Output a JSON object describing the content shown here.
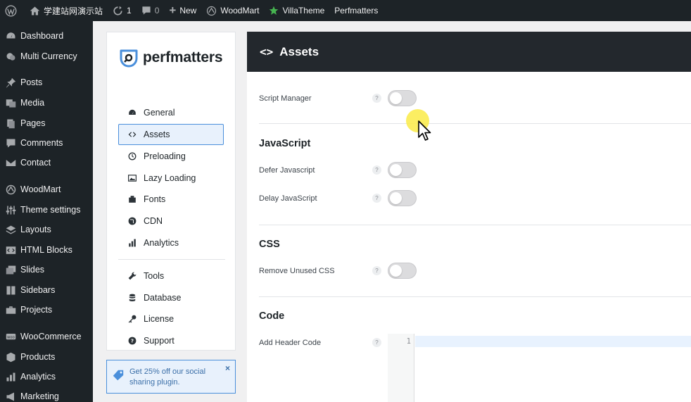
{
  "adminbar": {
    "site_name": "学建站网演示站",
    "updates_count": "1",
    "comments_count": "0",
    "new_label": "New",
    "woodmart_label": "WoodMart",
    "villatheme_label": "VillaTheme",
    "perfmatters_label": "Perfmatters"
  },
  "sidebar": {
    "items": [
      {
        "label": "Dashboard",
        "icon": "dashboard-icon"
      },
      {
        "label": "Multi Currency",
        "icon": "currency-icon"
      },
      {
        "label": "Posts",
        "icon": "pin-icon"
      },
      {
        "label": "Media",
        "icon": "media-icon"
      },
      {
        "label": "Pages",
        "icon": "pages-icon"
      },
      {
        "label": "Comments",
        "icon": "comment-icon"
      },
      {
        "label": "Contact",
        "icon": "mail-icon"
      },
      {
        "label": "WoodMart",
        "icon": "woodmart-icon"
      },
      {
        "label": "Theme settings",
        "icon": "sliders-icon"
      },
      {
        "label": "Layouts",
        "icon": "layers-icon"
      },
      {
        "label": "HTML Blocks",
        "icon": "html-icon"
      },
      {
        "label": "Slides",
        "icon": "slides-icon"
      },
      {
        "label": "Sidebars",
        "icon": "sidebars-icon"
      },
      {
        "label": "Projects",
        "icon": "briefcase-icon"
      },
      {
        "label": "WooCommerce",
        "icon": "woo-icon"
      },
      {
        "label": "Products",
        "icon": "box-icon"
      },
      {
        "label": "Analytics",
        "icon": "bar-chart-icon"
      },
      {
        "label": "Marketing",
        "icon": "megaphone-icon"
      }
    ]
  },
  "pm_nav": {
    "logo_text": "perfmatters",
    "items": [
      {
        "label": "General",
        "icon": "dashboard-icon"
      },
      {
        "label": "Assets",
        "icon": "code-icon"
      },
      {
        "label": "Preloading",
        "icon": "clock-icon"
      },
      {
        "label": "Lazy Loading",
        "icon": "image-icon"
      },
      {
        "label": "Fonts",
        "icon": "font-icon"
      },
      {
        "label": "CDN",
        "icon": "globe-icon"
      },
      {
        "label": "Analytics",
        "icon": "bar-chart-icon"
      },
      {
        "label": "Tools",
        "icon": "wrench-icon"
      },
      {
        "label": "Database",
        "icon": "database-icon"
      },
      {
        "label": "License",
        "icon": "key-icon"
      },
      {
        "label": "Support",
        "icon": "help-icon"
      }
    ],
    "active_index": 1
  },
  "promo": {
    "text": "Get 25% off our social sharing plugin.",
    "close": "×"
  },
  "main": {
    "header_icon": "<>",
    "title": "Assets",
    "help_glyph": "?",
    "settings": {
      "script_manager": {
        "label": "Script Manager",
        "enabled": false
      },
      "javascript_title": "JavaScript",
      "defer_js": {
        "label": "Defer Javascript",
        "enabled": false
      },
      "delay_js": {
        "label": "Delay JavaScript",
        "enabled": false
      },
      "css_title": "CSS",
      "remove_unused_css": {
        "label": "Remove Unused CSS",
        "enabled": false
      },
      "code_title": "Code",
      "header_code": {
        "label": "Add Header Code",
        "line_number": "1"
      }
    }
  },
  "colors": {
    "admin_bg": "#1d2327",
    "accent": "#4a8fdb",
    "header_bg": "#23282d"
  }
}
